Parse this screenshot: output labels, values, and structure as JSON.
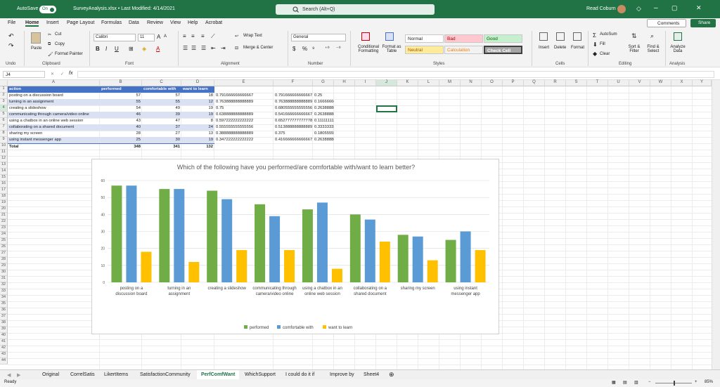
{
  "titlebar": {
    "autosave": "AutoSave",
    "toggle": "On",
    "filename": "SurveyAnalysis.xlsx • Last Modified: 4/14/2021",
    "search": "Search (Alt+Q)",
    "user": "Read Coburn"
  },
  "menu": [
    "File",
    "Home",
    "Insert",
    "Page Layout",
    "Formulas",
    "Data",
    "Review",
    "View",
    "Help",
    "Acrobat"
  ],
  "menu_right": {
    "comments": "Comments",
    "share": "Share"
  },
  "ribbon": {
    "groups": {
      "undo": "Undo",
      "clipboard": "Clipboard",
      "font": "Font",
      "alignment": "Alignment",
      "number": "Number",
      "styles": "Styles",
      "cells": "Cells",
      "editing": "Editing",
      "analysis": "Analysis"
    },
    "paste": "Paste",
    "cut": "Cut",
    "copy": "Copy",
    "format_painter": "Format Painter",
    "font_name": "Calibri",
    "font_size": "11",
    "wrap_text": "Wrap Text",
    "merge_center": "Merge & Center",
    "number_format": "General",
    "cond_format": "Conditional Formatting",
    "format_table": "Format as Table",
    "styles": {
      "normal": "Normal",
      "bad": "Bad",
      "good": "Good",
      "neutral": "Neutral",
      "calculation": "Calculation",
      "check_cell": "Check Cell"
    },
    "insert": "Insert",
    "delete": "Delete",
    "format": "Format",
    "autosum": "AutoSum",
    "fill": "Fill",
    "clear": "Clear",
    "sort_filter": "Sort & Filter",
    "find_select": "Find & Select",
    "analyze": "Analyze Data"
  },
  "namebox": "J4",
  "fx": "fx",
  "columns": [
    "A",
    "B",
    "C",
    "D",
    "E",
    "F",
    "G",
    "H",
    "I",
    "J",
    "K",
    "L",
    "M",
    "N",
    "O",
    "P",
    "Q",
    "R",
    "S",
    "T",
    "U",
    "V",
    "W",
    "X",
    "Y",
    "Z"
  ],
  "table": {
    "headers": [
      "action",
      "performed",
      "comfortable with",
      "want to learn"
    ],
    "rows": [
      [
        "posting on a discussion board",
        "57",
        "57",
        "18",
        "0.791666666666667",
        "0.791666666666667",
        "0.25"
      ],
      [
        "turning in an assignment",
        "55",
        "55",
        "12",
        "0.763888888888889",
        "0.763888888888889",
        "0.166666666666667"
      ],
      [
        "creating a slideshow",
        "54",
        "49",
        "19",
        "0.75",
        "0.680555555555556",
        "0.263888888888889"
      ],
      [
        "communicating through camera/video online",
        "46",
        "39",
        "19",
        "0.638888888888889",
        "0.541666666666667",
        "0.263888888888889"
      ],
      [
        "using a chatbox in an online web session",
        "43",
        "47",
        "8",
        "0.597222222222222",
        "0.652777777777778",
        "0.111111111111111"
      ],
      [
        "collaborating on a shared document",
        "40",
        "37",
        "24",
        "0.555555555555556",
        "0.513888888888889",
        "0.333333333333333"
      ],
      [
        "sharing my screen",
        "28",
        "27",
        "13",
        "0.388888888888889",
        "0.375",
        "0.180555555555556"
      ],
      [
        "using instant messenger app",
        "25",
        "30",
        "19",
        "0.347222222222222",
        "0.416666666666667",
        "0.263888888888889"
      ]
    ],
    "total": [
      "Total",
      "348",
      "341",
      "132"
    ]
  },
  "chart_data": {
    "type": "bar",
    "title": "Which of the following have you performed/are comfortable with/want to learn better?",
    "categories": [
      "posting on a discussion board",
      "turning in an assignment",
      "creating a slideshow",
      "communicating through camera/video online",
      "using a chatbox in an online web session",
      "collaborating on a shared document",
      "sharing my screen",
      "using instant messenger app"
    ],
    "series": [
      {
        "name": "performed",
        "values": [
          57,
          55,
          54,
          46,
          43,
          40,
          28,
          25
        ],
        "color": "#70ad47"
      },
      {
        "name": "comfortable with",
        "values": [
          57,
          55,
          49,
          39,
          47,
          37,
          27,
          30
        ],
        "color": "#5b9bd5"
      },
      {
        "name": "want to learn",
        "values": [
          18,
          12,
          19,
          19,
          8,
          24,
          13,
          19
        ],
        "color": "#ffc000"
      }
    ],
    "yticks": [
      "0",
      "10",
      "20",
      "30",
      "40",
      "50",
      "60"
    ],
    "ylim": [
      0,
      60
    ],
    "grid": true,
    "legend": "bottom"
  },
  "sheets": [
    "Original",
    "CorrelSatis",
    "LikertItems",
    "SatisfactionCommunity",
    "PerfComfWant",
    "WhichSupport",
    "I could do it if",
    "Improve by",
    "Sheet4"
  ],
  "active_sheet": "PerfComfWant",
  "status": {
    "ready": "Ready",
    "zoom": "85%"
  }
}
